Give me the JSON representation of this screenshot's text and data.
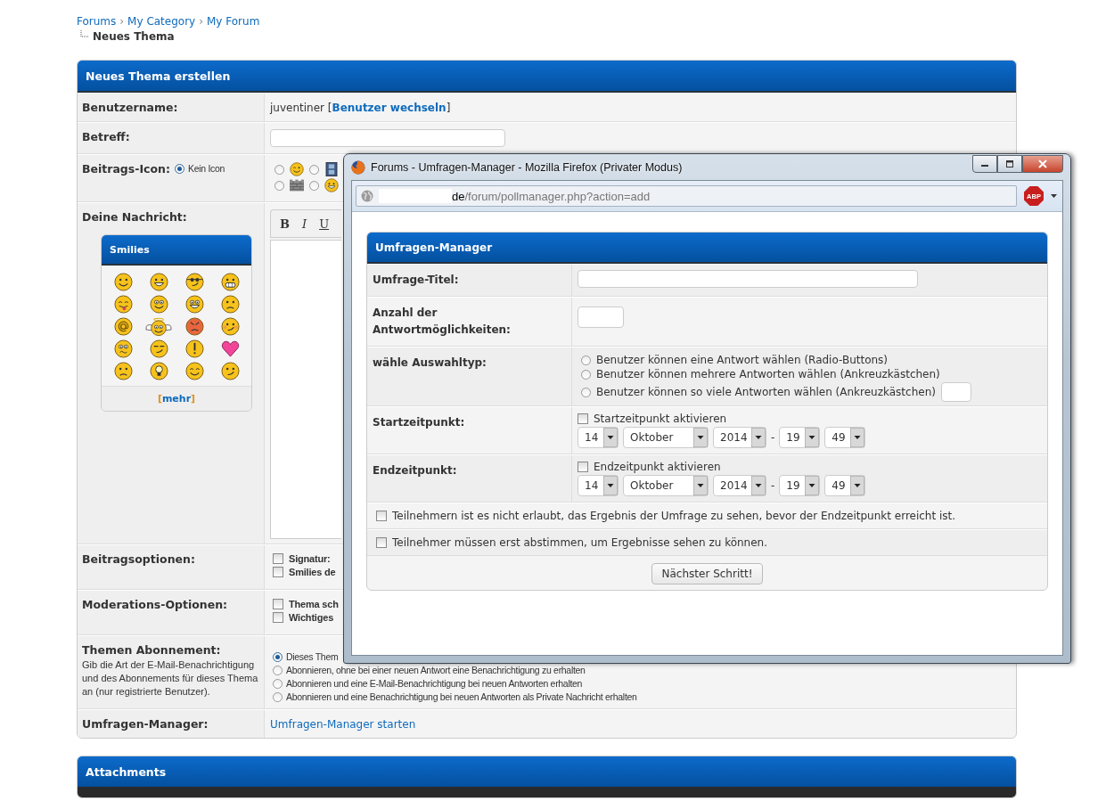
{
  "breadcrumb": {
    "links": [
      "Forums",
      "My Category",
      "My Forum"
    ],
    "separator": "›",
    "current": "Neues Thema"
  },
  "form": {
    "title": "Neues Thema erstellen",
    "username": {
      "label": "Benutzername:",
      "value": "juventiner",
      "brackets": [
        "[",
        "]"
      ],
      "link": "Benutzer wechseln"
    },
    "subject": {
      "label": "Betreff:"
    },
    "post_icon": {
      "label": "Beitrags-Icon:",
      "none_option": {
        "label": "Kein Icon",
        "selected": true
      },
      "icons": [
        {
          "kind": "wink",
          "selected": false
        },
        {
          "kind": "film",
          "selected": false
        },
        {
          "kind": "wall",
          "selected": false
        },
        {
          "kind": "grin",
          "selected": false
        }
      ]
    },
    "message": {
      "label": "Deine Nachricht:",
      "toolbar": [
        "B",
        "I",
        "U"
      ],
      "smilies": {
        "title": "Smilies",
        "more": "mehr",
        "brackets": [
          "[",
          "]"
        ],
        "items": [
          {
            "kind": "smile"
          },
          {
            "kind": "grin"
          },
          {
            "kind": "cool"
          },
          {
            "kind": "teeth"
          },
          {
            "kind": "tongue"
          },
          {
            "kind": "eyes"
          },
          {
            "kind": "happy"
          },
          {
            "kind": "frown"
          },
          {
            "kind": "at"
          },
          {
            "kind": "angel"
          },
          {
            "kind": "angry"
          },
          {
            "kind": "blush"
          },
          {
            "kind": "worried"
          },
          {
            "kind": "sly"
          },
          {
            "kind": "exclaim"
          },
          {
            "kind": "heart"
          },
          {
            "kind": "frown"
          },
          {
            "kind": "idea"
          },
          {
            "kind": "content"
          },
          {
            "kind": "smirk"
          }
        ]
      }
    },
    "post_options": {
      "label": "Beitragsoptionen:",
      "options": [
        {
          "label": "Signatur:",
          "checked": false
        },
        {
          "label": "Smilies de",
          "checked": false
        }
      ]
    },
    "mod_options": {
      "label": "Moderations-Optionen:",
      "options": [
        {
          "label": "Thema sch",
          "checked": false
        },
        {
          "label": "Wichtiges",
          "checked": false
        }
      ]
    },
    "subscription": {
      "label": "Themen Abonnement:",
      "hint": "Gib die Art der E-Mail-Benachrichtigung und des Abonnements für dieses Thema an (nur registrierte Benutzer).",
      "options": [
        {
          "label": "Dieses Them",
          "selected": true
        },
        {
          "label": "Abonnieren, ohne bei einer neuen Antwort eine Benachrichtigung zu erhalten",
          "selected": false
        },
        {
          "label": "Abonnieren und eine E-Mail-Benachrichtigung bei neuen Antworten erhalten",
          "selected": false
        },
        {
          "label": "Abonnieren und eine Benachrichtigung bei neuen Antworten als Private Nachricht erhalten",
          "selected": false
        }
      ]
    },
    "poll": {
      "label": "Umfragen-Manager:",
      "link": "Umfragen-Manager starten"
    }
  },
  "attachments": {
    "title": "Attachments"
  },
  "popup": {
    "title": "Forums - Umfragen-Manager - Mozilla Firefox (Privater Modus)",
    "url_host": "de",
    "url_path": "/forum/pollmanager.php?action=add",
    "addon_badge": "ABP",
    "panel": {
      "title": "Umfragen-Manager",
      "poll_title": {
        "label": "Umfrage-Titel:"
      },
      "answer_count": {
        "label": "Anzahl der Antwortmöglichkeiten:"
      },
      "choice_type": {
        "label": "wähle Auswahltyp:",
        "options": [
          {
            "label": "Benutzer können eine Antwort wählen (Radio-Buttons)",
            "selected": false
          },
          {
            "label": "Benutzer können mehrere Antworten wählen (Ankreuzkästchen)",
            "selected": false
          },
          {
            "label": "Benutzer können so viele Antworten wählen (Ankreuzkästchen)",
            "selected": false,
            "has_input": true
          }
        ]
      },
      "times": [
        {
          "label": "Startzeitpunkt:",
          "enable": {
            "label": "Startzeitpunkt aktivieren",
            "checked": false
          },
          "day": "14",
          "month": "Oktober",
          "year": "2014",
          "separator": "-",
          "hour": "19",
          "minute": "49"
        },
        {
          "label": "Endzeitpunkt:",
          "enable": {
            "label": "Endzeitpunkt aktivieren",
            "checked": false
          },
          "day": "14",
          "month": "Oktober",
          "year": "2014",
          "separator": "-",
          "hour": "19",
          "minute": "49"
        }
      ],
      "checks": [
        {
          "label": "Teilnehmern ist es nicht erlaubt, das Ergebnis der Umfrage zu sehen, bevor der Endzeitpunkt erreicht ist.",
          "checked": false
        },
        {
          "label": "Teilnehmer müssen erst abstimmen, um Ergebnisse sehen zu können.",
          "checked": false
        }
      ],
      "submit": "Nächster Schritt!"
    }
  }
}
